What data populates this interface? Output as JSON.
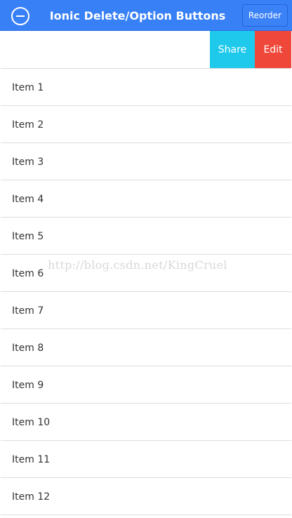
{
  "header": {
    "title": "Ionic Delete/Option Buttons",
    "reorder_label": "Reorder",
    "delete_toggle_icon": "minus-circle-icon",
    "background_color": "#3880f6"
  },
  "swiped_row": {
    "share_label": "Share",
    "edit_label": "Edit",
    "share_color": "#1ec9ec",
    "edit_color": "#ef473a"
  },
  "items": [
    {
      "label": "Item 1"
    },
    {
      "label": "Item 2"
    },
    {
      "label": "Item 3"
    },
    {
      "label": "Item 4"
    },
    {
      "label": "Item 5"
    },
    {
      "label": "Item 6"
    },
    {
      "label": "Item 7"
    },
    {
      "label": "Item 8"
    },
    {
      "label": "Item 9"
    },
    {
      "label": "Item 10"
    },
    {
      "label": "Item 11"
    },
    {
      "label": "Item 12"
    }
  ],
  "watermark": "http://blog.csdn.net/KingCruel"
}
